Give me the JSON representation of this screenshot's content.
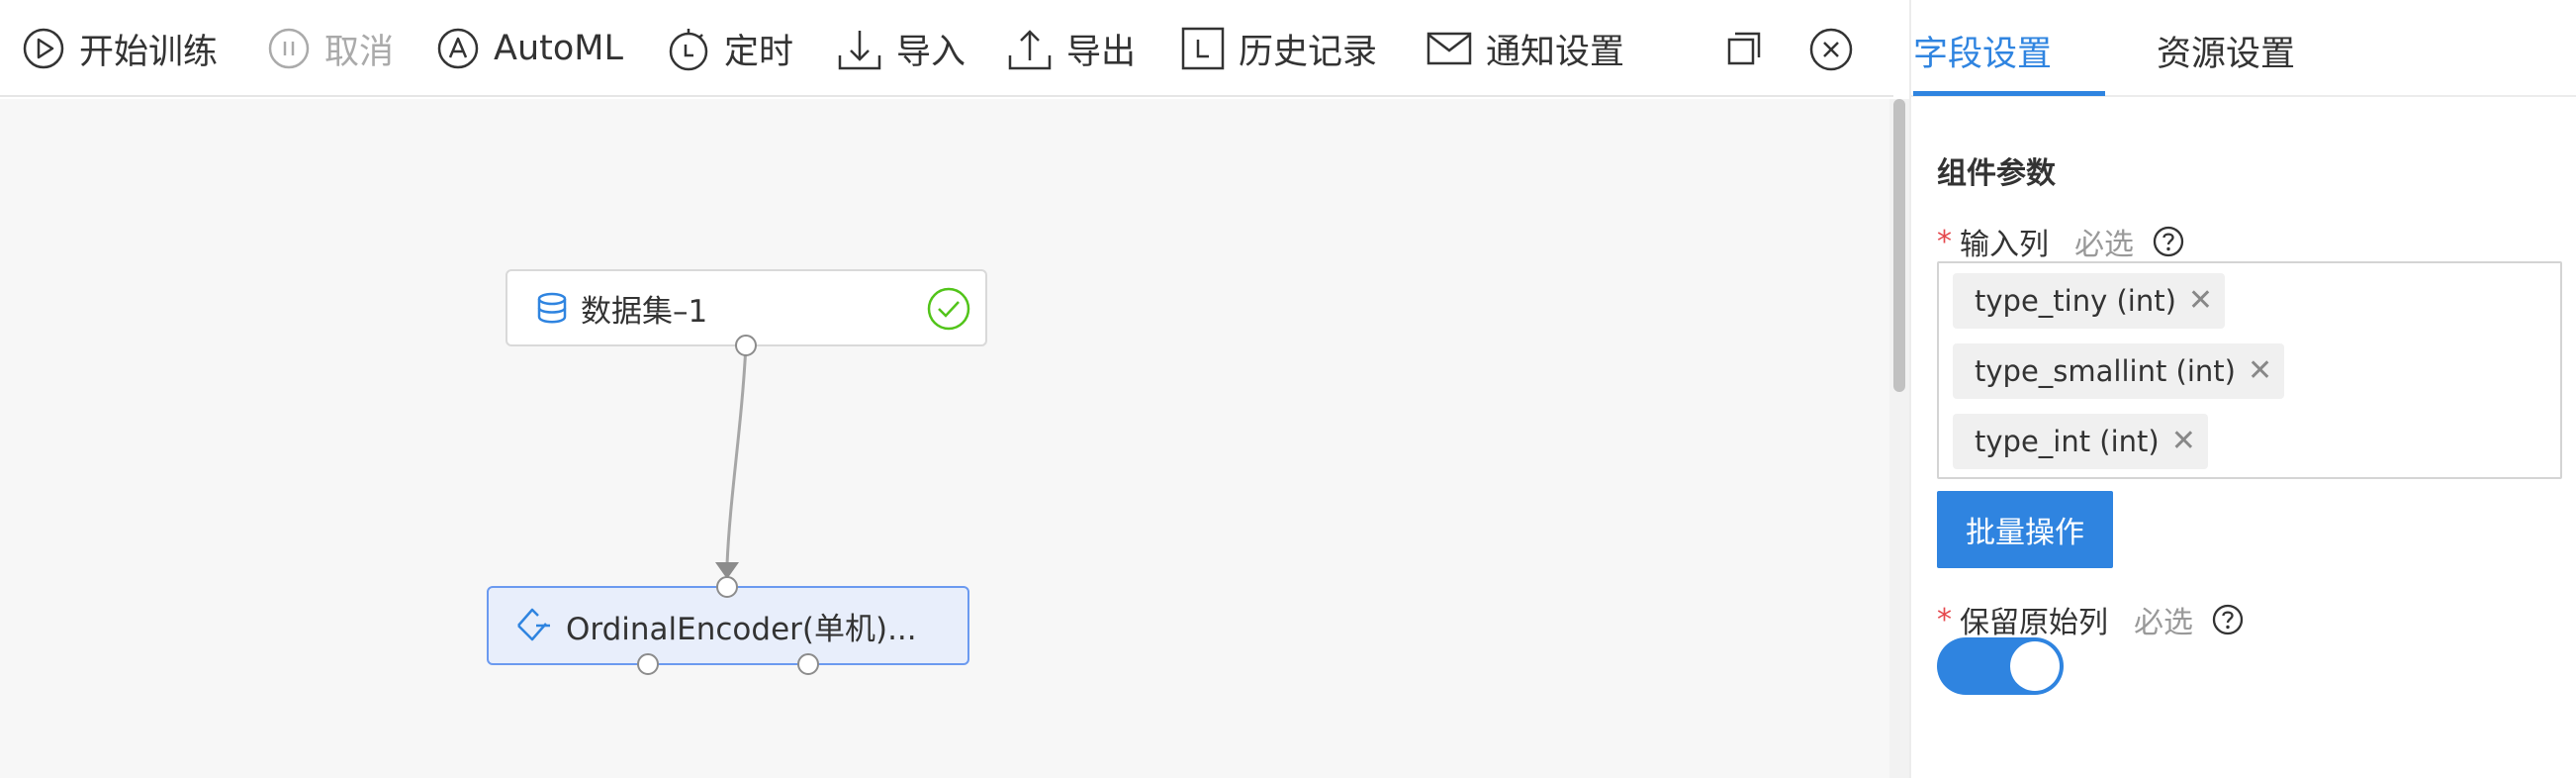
{
  "toolbar": {
    "start_training": "开始训练",
    "cancel": "取消",
    "automl": "AutoML",
    "schedule": "定时",
    "import": "导入",
    "export": "导出",
    "history": "历史记录",
    "notify": "通知设置",
    "icons": {
      "start_training": "play-icon",
      "cancel": "pause-icon",
      "automl": "automl-icon",
      "schedule": "timer-icon",
      "import": "download-icon",
      "export": "upload-icon",
      "history": "history-icon",
      "notify": "mail-icon",
      "copy": "copy-icon",
      "close": "close-icon"
    }
  },
  "canvas": {
    "nodes": [
      {
        "title": "数据集–1",
        "icon": "database-icon",
        "status": "success",
        "status_icon": "check-circle-icon"
      },
      {
        "title": "OrdinalEncoder(单机)...",
        "icon": "encoder-icon",
        "selected": true
      }
    ]
  },
  "panel": {
    "tabs": [
      {
        "label": "字段设置",
        "active": true
      },
      {
        "label": "资源设置",
        "active": false
      }
    ],
    "section_title": "组件参数",
    "input_columns": {
      "required_mark": "*",
      "label": "输入列",
      "hint": "必选",
      "tags": [
        {
          "label": "type_tiny (int)",
          "close": "✕"
        },
        {
          "label": "type_smallint (int)",
          "close": "✕"
        },
        {
          "label": "type_int (int)",
          "close": "✕"
        }
      ]
    },
    "batch_button": "批量操作",
    "keep_original": {
      "required_mark": "*",
      "label": "保留原始列",
      "hint": "必选",
      "value": true
    }
  },
  "colors": {
    "accent": "#2f84e0",
    "success": "#52c41a",
    "required": "#e5484d",
    "selected_node_bg": "#e8eefb",
    "selected_node_border": "#6b9af0"
  }
}
